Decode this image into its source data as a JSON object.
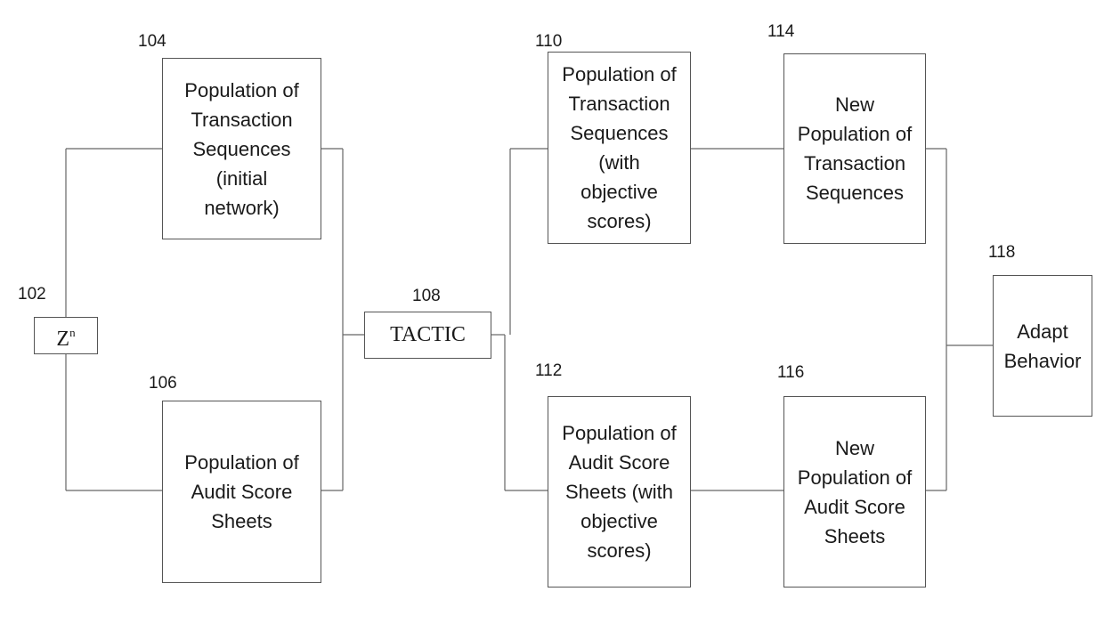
{
  "diagram": {
    "nodes": {
      "zn": {
        "ref": "102",
        "label": "Z",
        "superscript": "n"
      },
      "initial_population": {
        "ref": "104",
        "label": "Population of\nTransaction\nSequences\n(initial\nnetwork)"
      },
      "audit_population": {
        "ref": "106",
        "label": "Population of\nAudit Score\nSheets"
      },
      "tactic": {
        "ref": "108",
        "label": "TACTIC"
      },
      "scored_transactions": {
        "ref": "110",
        "label": "Population of\nTransaction\nSequences\n(with\nobjective\nscores)"
      },
      "scored_audit": {
        "ref": "112",
        "label": "Population of\nAudit Score\nSheets (with\nobjective\nscores)"
      },
      "new_transactions": {
        "ref": "114",
        "label": "New\nPopulation of\nTransaction\nSequences"
      },
      "new_audit": {
        "ref": "116",
        "label": "New\nPopulation of\nAudit Score\nSheets"
      },
      "adapt": {
        "ref": "118",
        "label": "Adapt\nBehavior"
      }
    },
    "edges": [
      [
        "zn",
        "initial_population"
      ],
      [
        "zn",
        "audit_population"
      ],
      [
        "initial_population",
        "tactic"
      ],
      [
        "audit_population",
        "tactic"
      ],
      [
        "tactic",
        "scored_transactions"
      ],
      [
        "tactic",
        "scored_audit"
      ],
      [
        "scored_transactions",
        "new_transactions"
      ],
      [
        "scored_audit",
        "new_audit"
      ],
      [
        "new_transactions",
        "adapt"
      ],
      [
        "new_audit",
        "adapt"
      ]
    ]
  }
}
